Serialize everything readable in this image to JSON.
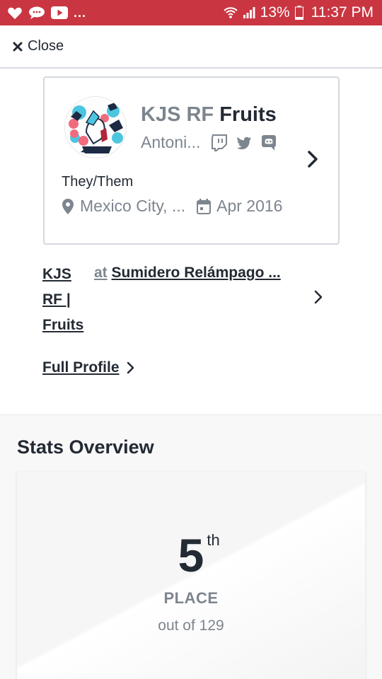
{
  "status_bar": {
    "dots": "...",
    "battery_pct": "13%",
    "time": "11:37 PM",
    "icons": [
      "heart-icon",
      "chat-bubble-icon",
      "youtube-icon",
      "wifi-icon",
      "signal-icon",
      "battery-icon"
    ]
  },
  "close": {
    "label": "Close",
    "icon": "close-x-icon"
  },
  "profile_card": {
    "team_tag": "KJS RF",
    "player_name": "Fruits",
    "real_name": "Antoni...",
    "social": [
      "twitch-icon",
      "twitter-icon",
      "discord-icon"
    ],
    "pronouns": "They/Them",
    "location": "Mexico City, ...",
    "joined": "Apr 2016"
  },
  "team_line": {
    "team_lines": [
      "KJS",
      "RF |",
      "Fruits"
    ],
    "at_label": "at",
    "venue": "Sumidero Relámpago ..."
  },
  "full_profile": {
    "label": "Full Profile"
  },
  "stats": {
    "title": "Stats Overview",
    "place_number": "5",
    "place_suffix": "th",
    "place_label": "PLACE",
    "out_of": "out of 129"
  },
  "colors": {
    "status_bar": "#c93641",
    "text_primary": "#232a33",
    "text_muted": "#7d858e"
  }
}
